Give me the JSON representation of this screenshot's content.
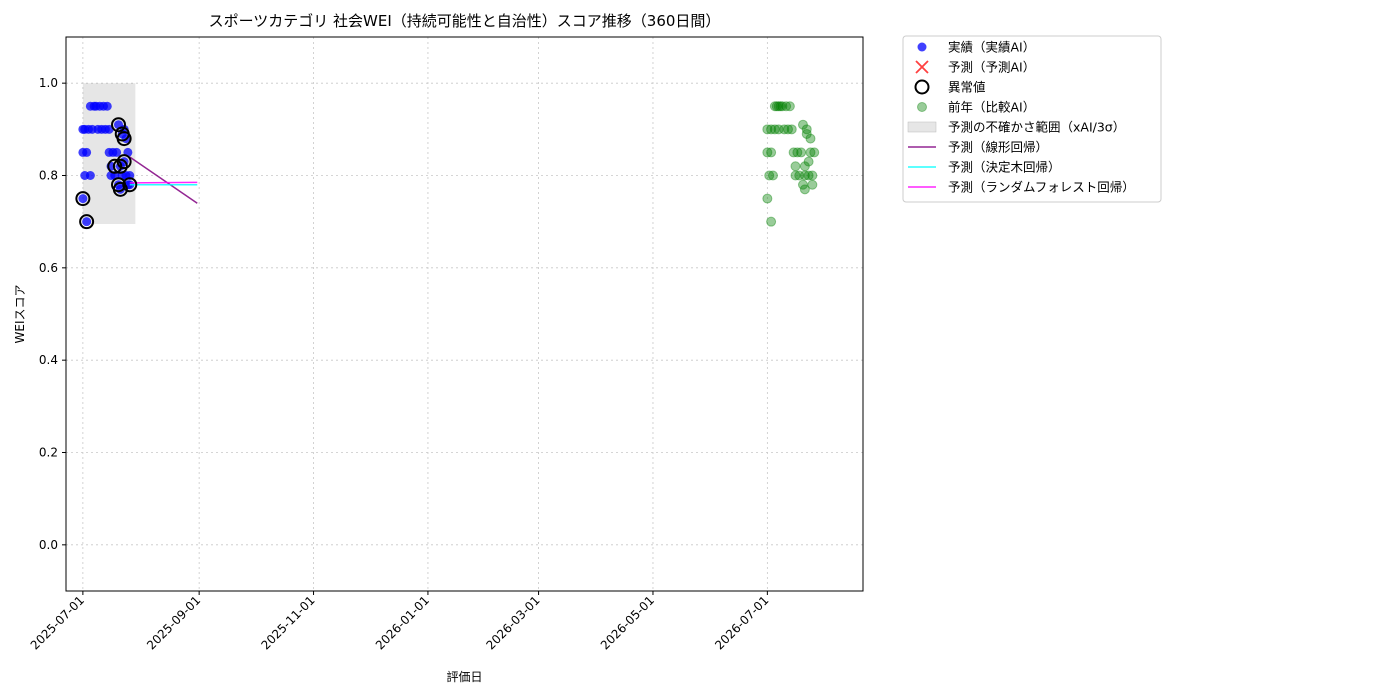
{
  "chart_data": {
    "type": "scatter",
    "title": "スポーツカテゴリ 社会WEI（持続可能性と自治性）スコア推移（360日間）",
    "xlabel": "評価日",
    "ylabel": "WEIスコア",
    "ylim": [
      -0.1,
      1.1
    ],
    "xlim": [
      "2025-06-22",
      "2026-08-21"
    ],
    "yticks": [
      0.0,
      0.2,
      0.4,
      0.6,
      0.8,
      1.0
    ],
    "yticklabels": [
      "0.0",
      "0.2",
      "0.4",
      "0.6",
      "0.8",
      "1.0"
    ],
    "xticks": [
      "2025-07-01",
      "2025-09-01",
      "2025-11-01",
      "2026-01-01",
      "2026-03-01",
      "2026-05-01",
      "2026-07-01"
    ],
    "grid": true,
    "legend_position": "outside-right",
    "legend": [
      {
        "label": "実績（実績AI）",
        "kind": "dot",
        "color": "#0000ff"
      },
      {
        "label": "予測（予測AI）",
        "kind": "x",
        "color": "#ff0000"
      },
      {
        "label": "異常値",
        "kind": "ring",
        "color": "#000000"
      },
      {
        "label": "前年（比較AI）",
        "kind": "dot",
        "color": "#008000"
      },
      {
        "label": "予測の不確かさ範囲（xAI/3σ）",
        "kind": "band",
        "color": "#cccccc"
      },
      {
        "label": "予測（線形回帰）",
        "kind": "line",
        "color": "#800080"
      },
      {
        "label": "予測（決定木回帰）",
        "kind": "line",
        "color": "#00ffff"
      },
      {
        "label": "予測（ランダムフォレスト回帰）",
        "kind": "line",
        "color": "#ff00ff"
      }
    ],
    "uncertainty_band": {
      "x": [
        "2025-07-01",
        "2025-07-29"
      ],
      "y": [
        0.695,
        1.0
      ]
    },
    "series": [
      {
        "name": "実績（実績AI）",
        "type": "scatter",
        "color": "#0000ff",
        "points": [
          [
            "2025-07-01",
            0.75
          ],
          [
            "2025-07-01",
            0.85
          ],
          [
            "2025-07-01",
            0.9
          ],
          [
            "2025-07-02",
            0.8
          ],
          [
            "2025-07-02",
            0.9
          ],
          [
            "2025-07-03",
            0.7
          ],
          [
            "2025-07-03",
            0.85
          ],
          [
            "2025-07-04",
            0.9
          ],
          [
            "2025-07-05",
            0.8
          ],
          [
            "2025-07-05",
            0.95
          ],
          [
            "2025-07-06",
            0.9
          ],
          [
            "2025-07-07",
            0.95
          ],
          [
            "2025-07-08",
            0.95
          ],
          [
            "2025-07-09",
            0.9
          ],
          [
            "2025-07-10",
            0.95
          ],
          [
            "2025-07-11",
            0.9
          ],
          [
            "2025-07-12",
            0.95
          ],
          [
            "2025-07-13",
            0.9
          ],
          [
            "2025-07-14",
            0.95
          ],
          [
            "2025-07-15",
            0.9
          ],
          [
            "2025-07-15",
            0.85
          ],
          [
            "2025-07-16",
            0.82
          ],
          [
            "2025-07-16",
            0.8
          ],
          [
            "2025-07-17",
            0.85
          ],
          [
            "2025-07-18",
            0.8
          ],
          [
            "2025-07-19",
            0.85
          ],
          [
            "2025-07-20",
            0.91
          ],
          [
            "2025-07-20",
            0.78
          ],
          [
            "2025-07-21",
            0.77
          ],
          [
            "2025-07-21",
            0.82
          ],
          [
            "2025-07-22",
            0.89
          ],
          [
            "2025-07-22",
            0.8
          ],
          [
            "2025-07-23",
            0.9
          ],
          [
            "2025-07-23",
            0.83
          ],
          [
            "2025-07-24",
            0.88
          ],
          [
            "2025-07-24",
            0.8
          ],
          [
            "2025-07-25",
            0.78
          ],
          [
            "2025-07-25",
            0.85
          ],
          [
            "2025-07-26",
            0.8
          ],
          [
            "2025-07-26",
            0.78
          ]
        ]
      },
      {
        "name": "異常値",
        "type": "scatter",
        "color": "#000000",
        "points": [
          [
            "2025-07-01",
            0.75
          ],
          [
            "2025-07-03",
            0.7
          ],
          [
            "2025-07-18",
            0.82
          ],
          [
            "2025-07-20",
            0.91
          ],
          [
            "2025-07-20",
            0.78
          ],
          [
            "2025-07-21",
            0.77
          ],
          [
            "2025-07-21",
            0.82
          ],
          [
            "2025-07-22",
            0.89
          ],
          [
            "2025-07-23",
            0.88
          ],
          [
            "2025-07-23",
            0.83
          ],
          [
            "2025-07-26",
            0.78
          ]
        ]
      },
      {
        "name": "前年（比較AI）",
        "type": "scatter",
        "color": "#008000",
        "points": [
          [
            "2026-07-01",
            0.75
          ],
          [
            "2026-07-01",
            0.85
          ],
          [
            "2026-07-01",
            0.9
          ],
          [
            "2026-07-02",
            0.8
          ],
          [
            "2026-07-03",
            0.7
          ],
          [
            "2026-07-03",
            0.85
          ],
          [
            "2026-07-03",
            0.9
          ],
          [
            "2026-07-04",
            0.8
          ],
          [
            "2026-07-05",
            0.9
          ],
          [
            "2026-07-05",
            0.95
          ],
          [
            "2026-07-06",
            0.95
          ],
          [
            "2026-07-07",
            0.9
          ],
          [
            "2026-07-07",
            0.95
          ],
          [
            "2026-07-08",
            0.95
          ],
          [
            "2026-07-09",
            0.95
          ],
          [
            "2026-07-10",
            0.9
          ],
          [
            "2026-07-11",
            0.95
          ],
          [
            "2026-07-12",
            0.9
          ],
          [
            "2026-07-13",
            0.95
          ],
          [
            "2026-07-14",
            0.9
          ],
          [
            "2026-07-15",
            0.85
          ],
          [
            "2026-07-16",
            0.8
          ],
          [
            "2026-07-16",
            0.82
          ],
          [
            "2026-07-17",
            0.85
          ],
          [
            "2026-07-18",
            0.8
          ],
          [
            "2026-07-19",
            0.85
          ],
          [
            "2026-07-20",
            0.91
          ],
          [
            "2026-07-20",
            0.78
          ],
          [
            "2026-07-21",
            0.77
          ],
          [
            "2026-07-21",
            0.82
          ],
          [
            "2026-07-21",
            0.8
          ],
          [
            "2026-07-22",
            0.89
          ],
          [
            "2026-07-22",
            0.9
          ],
          [
            "2026-07-23",
            0.83
          ],
          [
            "2026-07-23",
            0.8
          ],
          [
            "2026-07-24",
            0.88
          ],
          [
            "2026-07-24",
            0.85
          ],
          [
            "2026-07-25",
            0.78
          ],
          [
            "2026-07-25",
            0.8
          ],
          [
            "2026-07-26",
            0.85
          ]
        ]
      },
      {
        "name": "予測（線形回帰）",
        "type": "line",
        "color": "#800080",
        "points": [
          [
            "2025-07-26",
            0.84
          ],
          [
            "2025-08-31",
            0.74
          ]
        ]
      },
      {
        "name": "予測（決定木回帰）",
        "type": "line",
        "color": "#00ffff",
        "points": [
          [
            "2025-07-26",
            0.78
          ],
          [
            "2025-08-31",
            0.78
          ]
        ]
      },
      {
        "name": "予測（ランダムフォレスト回帰）",
        "type": "line",
        "color": "#ff00ff",
        "points": [
          [
            "2025-07-26",
            0.784
          ],
          [
            "2025-08-31",
            0.785
          ]
        ]
      }
    ]
  }
}
